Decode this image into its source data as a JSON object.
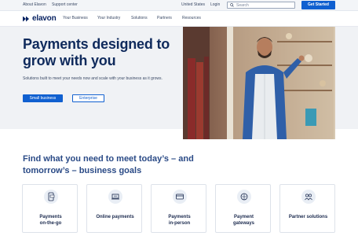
{
  "utility": {
    "about": "About Elavon",
    "support": "Support center",
    "region": "United States",
    "login": "Login"
  },
  "header": {
    "logo_text": "elavon",
    "nav": [
      "Your Business",
      "Your Industry",
      "Solutions",
      "Partners",
      "Resources"
    ],
    "search_placeholder": "Search",
    "cta": "Get Started"
  },
  "hero": {
    "title": "Payments designed to grow with you",
    "subtitle": "Solutions built to meet your needs now and scale with your business as it grows.",
    "primary_button": "Small business",
    "secondary_button": "Enterprise"
  },
  "section": {
    "heading": "Find what you need to meet today’s – and tomorrow’s – business goals"
  },
  "cards": [
    {
      "label": "Payments\non-the-go",
      "icon": "mobile-payment-icon"
    },
    {
      "label": "Online payments",
      "icon": "laptop-payment-icon"
    },
    {
      "label": "Payments\nin-person",
      "icon": "card-terminal-icon"
    },
    {
      "label": "Payment\ngateways",
      "icon": "gateway-icon"
    },
    {
      "label": "Partner solutions",
      "icon": "partners-icon"
    }
  ],
  "colors": {
    "brand_navy": "#0a2463",
    "accent_blue": "#1060d0",
    "hero_bg": "#f0f2f5"
  }
}
